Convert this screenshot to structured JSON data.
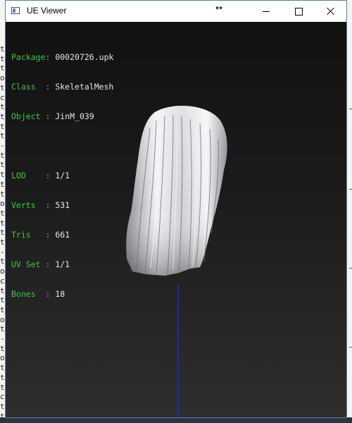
{
  "window": {
    "title": "UE Viewer",
    "cursor_glyph": "↔"
  },
  "controls": {
    "minimize": "minimize-icon",
    "maximize": "maximize-icon",
    "close": "close-icon"
  },
  "info": {
    "package": {
      "key": "Package:",
      "value": "00020726.upk"
    },
    "class": {
      "key": "Class  :",
      "value": "SkeletalMesh"
    },
    "object": {
      "key": "Object :",
      "value": "JinM_039"
    },
    "lod": {
      "key": "LOD    :",
      "value": "1/1"
    },
    "verts": {
      "key": "Verts  :",
      "value": "531"
    },
    "tris": {
      "key": "Tris   :",
      "value": "661"
    },
    "uvset": {
      "key": "UV Set :",
      "value": "1/1"
    },
    "bones": {
      "key": "Bones  :",
      "value": "18"
    }
  },
  "background_window": {
    "chars": [
      "t",
      "t",
      "t",
      "o",
      "t",
      "c",
      "t",
      "t",
      "t",
      "t",
      "-",
      "t",
      "t",
      "t",
      "t",
      "t",
      "o",
      "t",
      "t",
      "t",
      "t",
      "-",
      "t",
      "o",
      "c",
      "t",
      "t",
      "t",
      "o",
      "t",
      "-",
      "t",
      "o",
      "t",
      "t",
      "t",
      "c",
      "t",
      "t"
    ]
  },
  "colors": {
    "info_key": "#3cc83c",
    "info_value": "#e6e6e6",
    "axis_line": "#1a2bd0",
    "border": "#5a7fa8"
  }
}
